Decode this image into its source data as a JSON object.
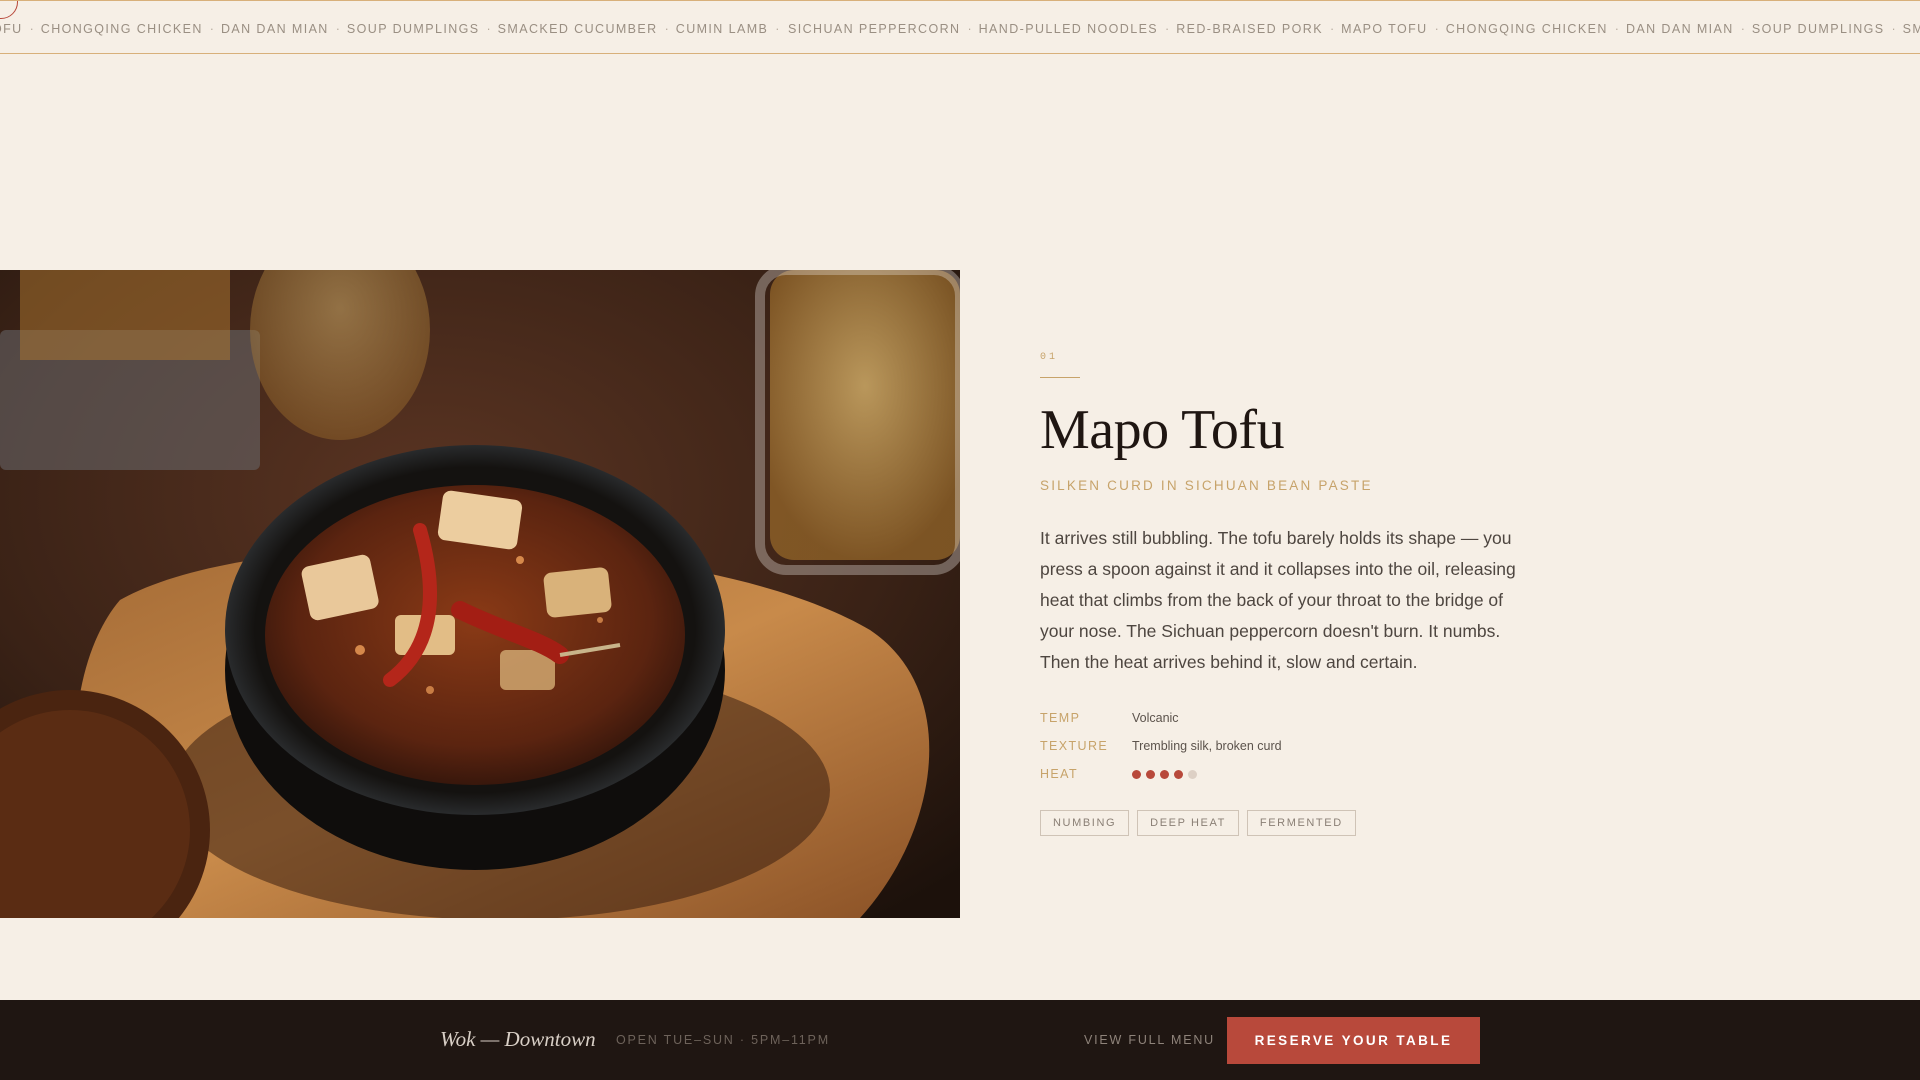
{
  "marquee": {
    "row_1": [
      "OFU",
      "CHONGQING CHICKEN",
      "DAN DAN MIAN",
      "SOUP DUMPLINGS",
      "SMACKED CUCUMBER",
      "CUMIN LAMB"
    ],
    "row_2": [
      "SICHUAN PEPPERCORN",
      "HAND-PULLED NOODLES",
      "RED-BRAISED PORK",
      "MAPO TOFU",
      "CHONGQING CHICKEN",
      "DAN DAN MIAN",
      "SOUP DUMPLINGS",
      "SMACKED CUC"
    ],
    "separator": "·"
  },
  "dish": {
    "index": "01",
    "name": "Mapo Tofu",
    "subtitle": "SILKEN CURD IN SICHUAN BEAN PASTE",
    "description": "It arrives still bubbling. The tofu barely holds its shape — you press a spoon against it and it collapses into the oil, releasing heat that climbs from the back of your throat to the bridge of your nose. The Sichuan peppercorn doesn't burn. It numbs. Then the heat arrives behind it, slow and certain.",
    "specs": {
      "temp_label": "TEMP",
      "temp_value": "Volcanic",
      "texture_label": "TEXTURE",
      "texture_value": "Trembling silk, broken curd",
      "heat_label": "HEAT",
      "heat_level": 4,
      "heat_max": 5
    },
    "tags": [
      "NUMBING",
      "DEEP HEAT",
      "FERMENTED"
    ]
  },
  "footer": {
    "brand": "Wok — Downtown",
    "hours": "OPEN TUE–SUN · 5PM–11PM",
    "menu_link": "VIEW FULL MENU",
    "cta": "RESERVE YOUR TABLE"
  },
  "colors": {
    "background": "#f6efe6",
    "accent_gold": "#c7a36a",
    "accent_red": "#b8493b",
    "footer_bg": "#1f1612"
  }
}
